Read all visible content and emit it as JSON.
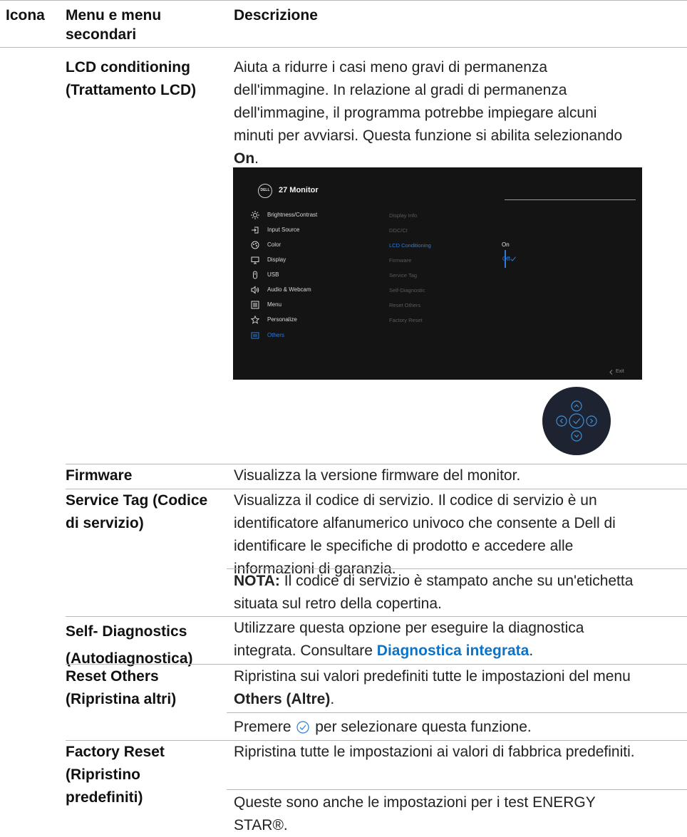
{
  "header": {
    "icon_col": "Icona",
    "menu_col": "Menu e menu secondari",
    "desc_col": "Descrizione"
  },
  "rows": [
    {
      "name": "LCD conditioning (Trattamento LCD)",
      "desc": "Aiuta a ridurre i casi meno gravi di permanenza dell'immagine. In relazione al gradi di permanenza dell'immagine, il programma potrebbe impiegare alcuni minuti per avviarsi. Questa funzione si abilita selezionando",
      "desc_bold": "On",
      "desc_end": "."
    },
    {
      "name": "Firmware",
      "desc": "Visualizza la versione firmware del monitor."
    },
    {
      "name": "Service Tag (Codice di servizio)",
      "desc": "Visualizza il codice di servizio. Il codice di servizio è un identificatore alfanumerico univoco che consente a Dell di identificare le specifiche di prodotto e accedere alle informazioni di garanzia.",
      "note_label": "NOTA:",
      "note": "Il codice di servizio è stampato anche su un'etichetta situata sul retro della copertina."
    },
    {
      "name": "Self- Diagnostics (Autodiagnostica)",
      "desc": "Utilizzare questa opzione per eseguire la diagnostica integrata. Consultare",
      "link": "Diagnostica integrata",
      "desc_end": "."
    },
    {
      "name": "Reset Others (Ripristina altri)",
      "desc": "Ripristina sui valori predefiniti tutte le impostazioni del menu",
      "desc_bold": "Others (Altre)",
      "desc_end": ".",
      "extra_pre": "Premere",
      "extra_post": "per selezionare questa funzione."
    },
    {
      "name": "Factory Reset (Ripristino predefiniti)",
      "desc": "Ripristina tutte le impostazioni ai valori di fabbrica predefiniti.",
      "extra": "Queste sono anche le impostazioni per i test ENERGY STAR®."
    }
  ],
  "osd": {
    "logo": "DELL",
    "title": "27 Monitor",
    "menu": [
      {
        "label": "Brightness/Contrast",
        "icon": "brightness-icon"
      },
      {
        "label": "Input Source",
        "icon": "input-source-icon"
      },
      {
        "label": "Color",
        "icon": "color-icon"
      },
      {
        "label": "Display",
        "icon": "display-icon"
      },
      {
        "label": "USB",
        "icon": "usb-icon"
      },
      {
        "label": "Audio & Webcam",
        "icon": "audio-icon"
      },
      {
        "label": "Menu",
        "icon": "menu-icon"
      },
      {
        "label": "Personalize",
        "icon": "star-icon"
      },
      {
        "label": "Others",
        "icon": "others-icon",
        "active": true
      }
    ],
    "submenu": [
      {
        "label": "Display Info"
      },
      {
        "label": "DDC/CI"
      },
      {
        "label": "LCD Conditioning",
        "active": true
      },
      {
        "label": "Firmware"
      },
      {
        "label": "Service Tag"
      },
      {
        "label": "Self-Diagnostic"
      },
      {
        "label": "Reset Others"
      },
      {
        "label": "Factory Reset"
      }
    ],
    "options": [
      {
        "label": "On"
      },
      {
        "label": "Off",
        "selected": true
      }
    ],
    "exit": "Exit",
    "accent": "#2f7bd6"
  },
  "colors": {
    "link": "#0b74c9",
    "rule": "#b9b9b9"
  }
}
